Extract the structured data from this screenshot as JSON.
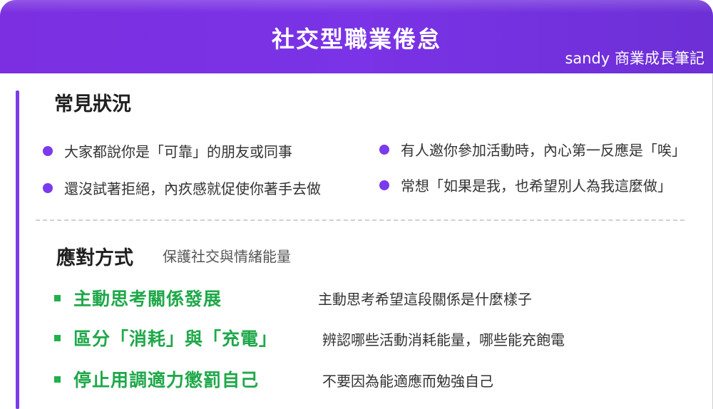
{
  "header": {
    "title": "社交型職業倦怠",
    "author": "sandy 商業成長筆記"
  },
  "situations": {
    "heading": "常見狀況",
    "items": [
      "大家都說你是「可靠」的朋友或同事",
      "有人邀你參加活動時，內心第一反應是「唉」",
      "還沒試著拒絕，內疚感就促使你著手去做",
      "常想「如果是我，也希望別人為我這麼做」"
    ]
  },
  "coping": {
    "heading": "應對方式",
    "subtitle": "保護社交與情緒能量",
    "methods": [
      {
        "title": "主動思考關係發展",
        "desc": "主動思考希望這段關係是什麼樣子"
      },
      {
        "title": "區分「消耗」與「充電」",
        "desc": "辨認哪些活動消耗能量，哪些能充飽電"
      },
      {
        "title": "停止用調適力懲罰自己",
        "desc": "不要因為能適應而勉強自己"
      }
    ]
  },
  "colors": {
    "header_purple": "#7b2fe0",
    "bullet_purple": "#7c3aed",
    "method_green": "#1fa84a"
  }
}
